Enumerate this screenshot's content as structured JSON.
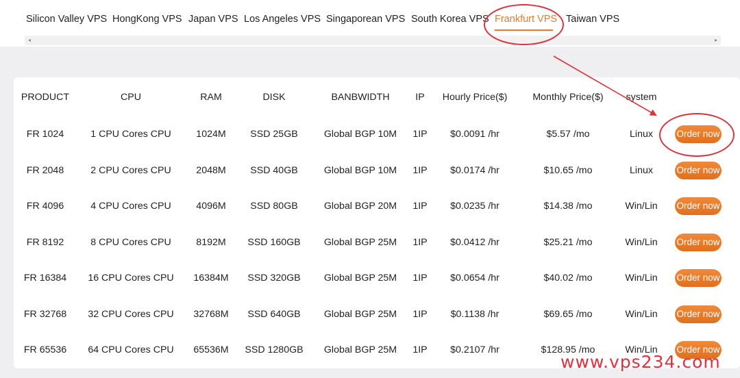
{
  "tabs": [
    {
      "label": "Silicon Valley VPS"
    },
    {
      "label": "HongKong VPS"
    },
    {
      "label": "Japan VPS"
    },
    {
      "label": "Los Angeles VPS"
    },
    {
      "label": "Singaporean VPS"
    },
    {
      "label": "South Korea VPS"
    },
    {
      "label": "Frankfurt VPS",
      "active": true
    },
    {
      "label": "Taiwan VPS"
    }
  ],
  "scrollbar": {
    "left_arrow": "◂",
    "right_arrow": "▸"
  },
  "table": {
    "headers": [
      "PRODUCT",
      "CPU",
      "RAM",
      "DISK",
      "BANBWIDTH",
      "IP",
      "Hourly Price($)",
      "Monthly Price($)",
      "system"
    ],
    "rows": [
      [
        "FR 1024",
        "1 CPU Cores CPU",
        "1024M",
        "SSD 25GB",
        "Global BGP 10M",
        "1IP",
        "$0.0091 /hr",
        "$5.57 /mo",
        "Linux"
      ],
      [
        "FR 2048",
        "2 CPU Cores CPU",
        "2048M",
        "SSD 40GB",
        "Global BGP 10M",
        "1IP",
        "$0.0174 /hr",
        "$10.65 /mo",
        "Linux"
      ],
      [
        "FR 4096",
        "4 CPU Cores CPU",
        "4096M",
        "SSD 80GB",
        "Global BGP 20M",
        "1IP",
        "$0.0235 /hr",
        "$14.38 /mo",
        "Win/Lin"
      ],
      [
        "FR 8192",
        "8 CPU Cores CPU",
        "8192M",
        "SSD 160GB",
        "Global BGP 25M",
        "1IP",
        "$0.0412 /hr",
        "$25.21 /mo",
        "Win/Lin"
      ],
      [
        "FR 16384",
        "16 CPU Cores CPU",
        "16384M",
        "SSD 320GB",
        "Global BGP 25M",
        "1IP",
        "$0.0654 /hr",
        "$40.02 /mo",
        "Win/Lin"
      ],
      [
        "FR 32768",
        "32 CPU Cores CPU",
        "32768M",
        "SSD 640GB",
        "Global BGP 25M",
        "1IP",
        "$0.1138 /hr",
        "$69.65 /mo",
        "Win/Lin"
      ],
      [
        "FR 65536",
        "64 CPU Cores CPU",
        "65536M",
        "SSD 1280GB",
        "Global BGP 25M",
        "1IP",
        "$0.2107 /hr",
        "$128.95 /mo",
        "Win/Lin"
      ]
    ],
    "order_label": "Order now"
  },
  "watermark": "www.vps234.com",
  "colors": {
    "accent": "#e57a2c",
    "annotation": "#d9333b",
    "watermark": "#e0313f"
  }
}
